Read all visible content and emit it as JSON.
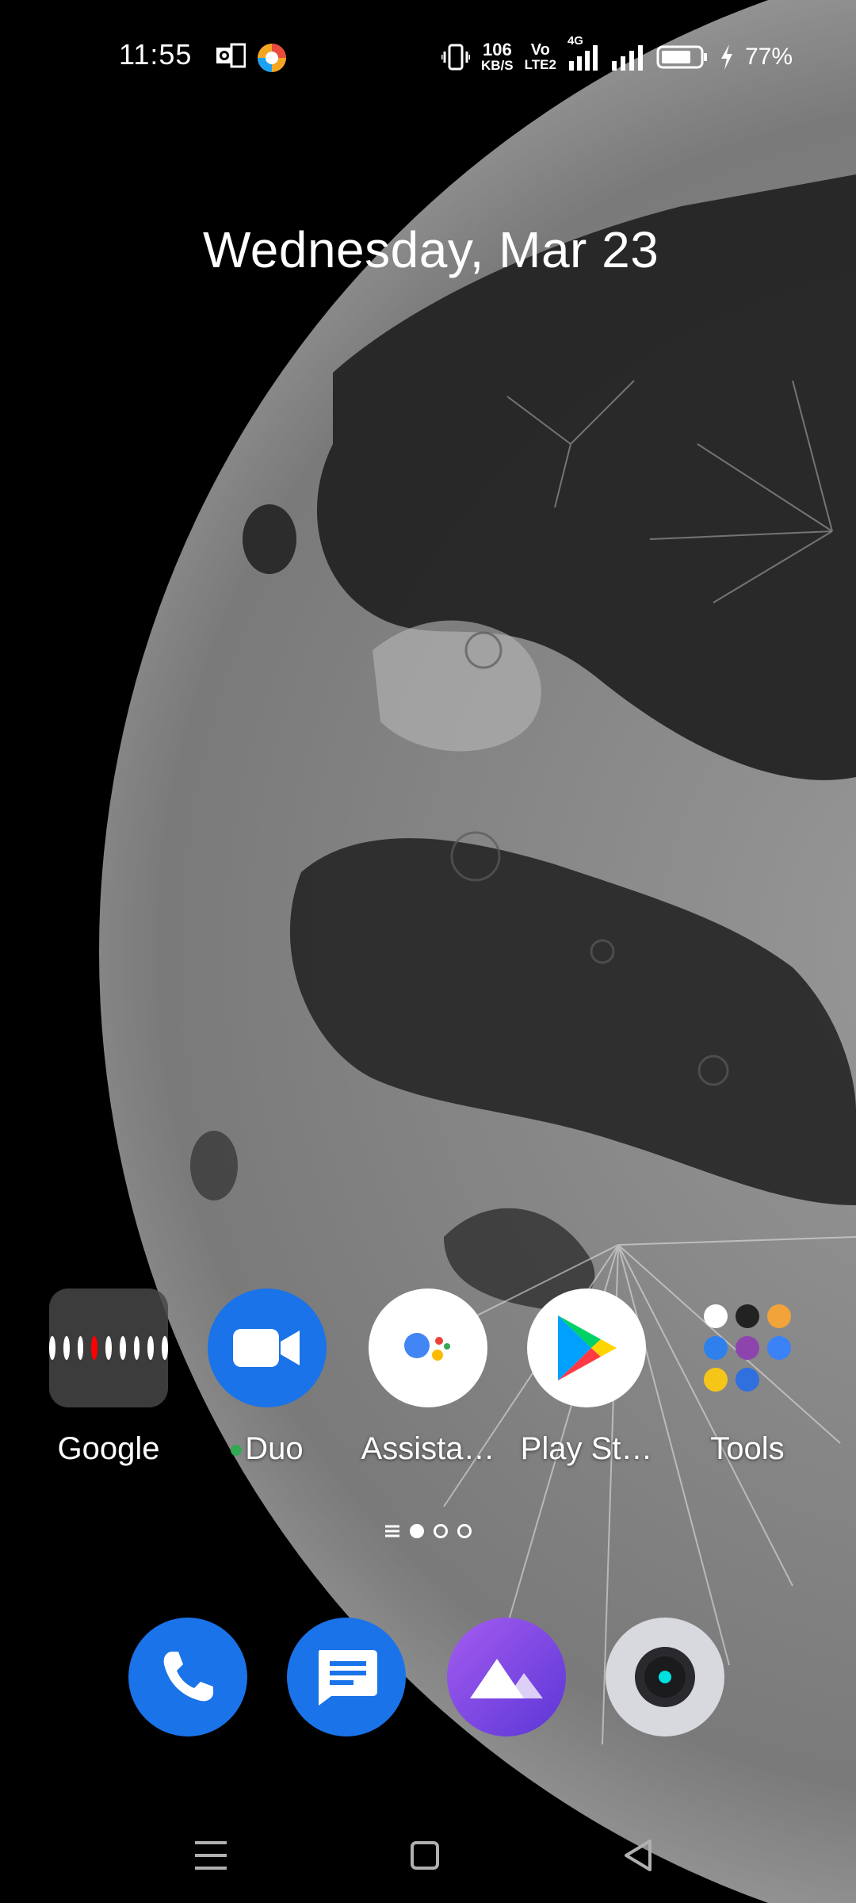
{
  "status_bar": {
    "time": "11:55",
    "network_speed": "106",
    "network_speed_unit": "KB/S",
    "volte_top": "Vo",
    "volte_bottom": "LTE2",
    "network_type": "4G",
    "battery": "77%"
  },
  "date_widget": {
    "text": "Wednesday, Mar 23"
  },
  "home_apps": [
    {
      "label": "Google",
      "icon": "google-folder-icon"
    },
    {
      "label": "Duo",
      "icon": "duo-icon"
    },
    {
      "label": "Assista…",
      "icon": "assistant-icon"
    },
    {
      "label": "Play St…",
      "icon": "play-store-icon"
    },
    {
      "label": "Tools",
      "icon": "tools-folder-icon"
    }
  ],
  "page_indicator": {
    "pages": 3,
    "active": 1
  },
  "dock": [
    {
      "icon": "phone-icon",
      "color": "#1a73e8"
    },
    {
      "icon": "messages-icon",
      "color": "#1a73e8"
    },
    {
      "icon": "photos-icon",
      "color": "#7b3fe4"
    },
    {
      "icon": "camera-icon",
      "color": "#d7d9de"
    }
  ],
  "colors": {
    "duo_dot": "#34a853",
    "accent_blue": "#1a73e8"
  }
}
